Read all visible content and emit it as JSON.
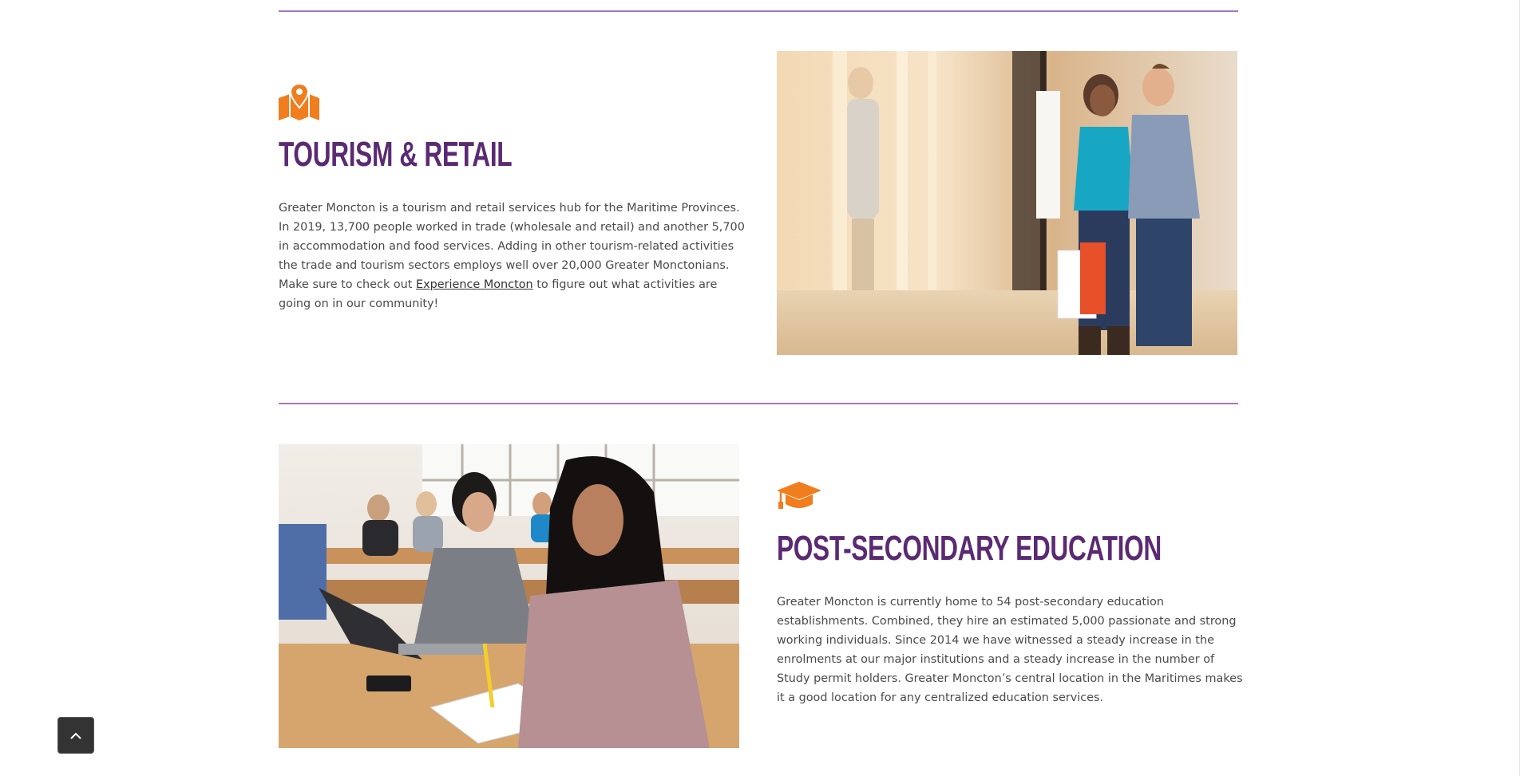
{
  "tourism": {
    "title": "TOURISM & RETAIL",
    "paragraph_before_link": "Greater Moncton is a tourism and retail services hub for the Maritime Provinces. In 2019, 13,700 people worked in trade (wholesale and retail) and another 5,700 in accommodation and food services. Adding in other tourism-related activities the trade and tourism sectors employs well over 20,000 Greater Monctonians. Make sure to check out ",
    "link_text": "Experience Moncton",
    "paragraph_after_link": " to figure out what activities are going on in our community!",
    "icon": "map-pin-icon"
  },
  "education": {
    "title": "POST-SECONDARY EDUCATION",
    "paragraph": "Greater Moncton is currently home to 54 post-secondary education establishments. Combined, they hire an estimated 5,000 passionate and strong working individuals. Since 2014 we have witnessed a steady increase in the enrolments at our major institutions and a steady increase in the number of Study permit holders. Greater Moncton’s central location in the Maritimes makes it a good location for any centralized education services.",
    "icon": "graduation-cap-icon"
  },
  "colors": {
    "heading": "#5b2a73",
    "icon_accent": "#f07d1e",
    "divider": "#9b59b6"
  },
  "scroll_top_button": {
    "icon": "chevron-up-icon"
  }
}
